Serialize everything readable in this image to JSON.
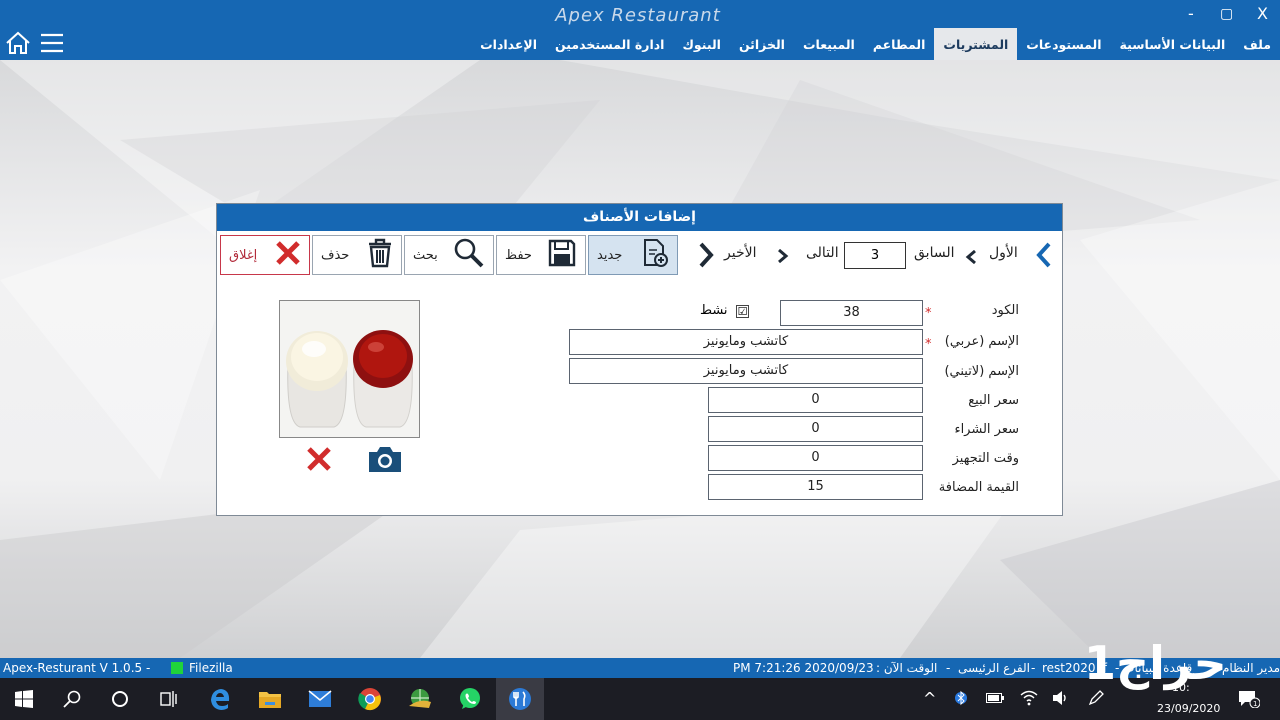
{
  "app": {
    "title": "Apex Restaurant",
    "min_label": "-",
    "max_label": "▢",
    "close_label": "X"
  },
  "menu": [
    "ملف",
    "البيانات الأساسية",
    "المستودعات",
    "المشتريات",
    "المطاعم",
    "المبيعات",
    "الخزائن",
    "البنوك",
    "ادارة المستخدمين",
    "الإعدادات"
  ],
  "menu_active": "المشتريات",
  "dialog": {
    "title": "إضافات الأصناف",
    "toolbar": {
      "new": "جديد",
      "save": "حفظ",
      "search": "بحث",
      "delete": "حذف",
      "close": "إغلاق"
    },
    "nav": {
      "first": "الأول",
      "prev": "السابق",
      "page": "3",
      "next": "التالى",
      "last": "الأخير"
    },
    "fields": {
      "code_label": "الكود",
      "code": "38",
      "active_label": "نشط",
      "active_check": "☑",
      "name_ar_label": "الإسم (عربي)",
      "name_ar": "كاتشب ومايونيز",
      "name_en_label": "الإسم (لاتيني)",
      "name_en": "كاتشب ومايونيز",
      "sale_price_label": "سعر البيع",
      "sale_price": "0",
      "purchase_price_label": "سعر الشراء",
      "purchase_price": "0",
      "prep_time_label": "وقت التجهيز",
      "prep_time": "0",
      "vat_label": "القيمة المضافة",
      "vat": "15",
      "required_mark": "*"
    }
  },
  "status": {
    "version": "Apex-Resturant V 1.0.5  -",
    "filezilla": "Filezilla",
    "datetime": "PM 7:21:26 2020/09/23",
    "now_label": ":  الوقت الآن",
    "sep1": "-",
    "branch": "الفرع الرئيسى",
    "sep2": "-",
    "db": "rest2020 if",
    "sep3": "-  قاعدة البيانات",
    "user": "مدير النظام"
  },
  "taskbar": {
    "apps": [
      "windows-start",
      "search",
      "cortana",
      "task-view",
      "edge",
      "file-explorer",
      "mail",
      "chrome",
      "internet-download",
      "whatsapp",
      "apex-restaurant"
    ],
    "tray_date": "23/09/2020",
    "tray_time": "10:"
  },
  "watermark": "حراج1"
}
